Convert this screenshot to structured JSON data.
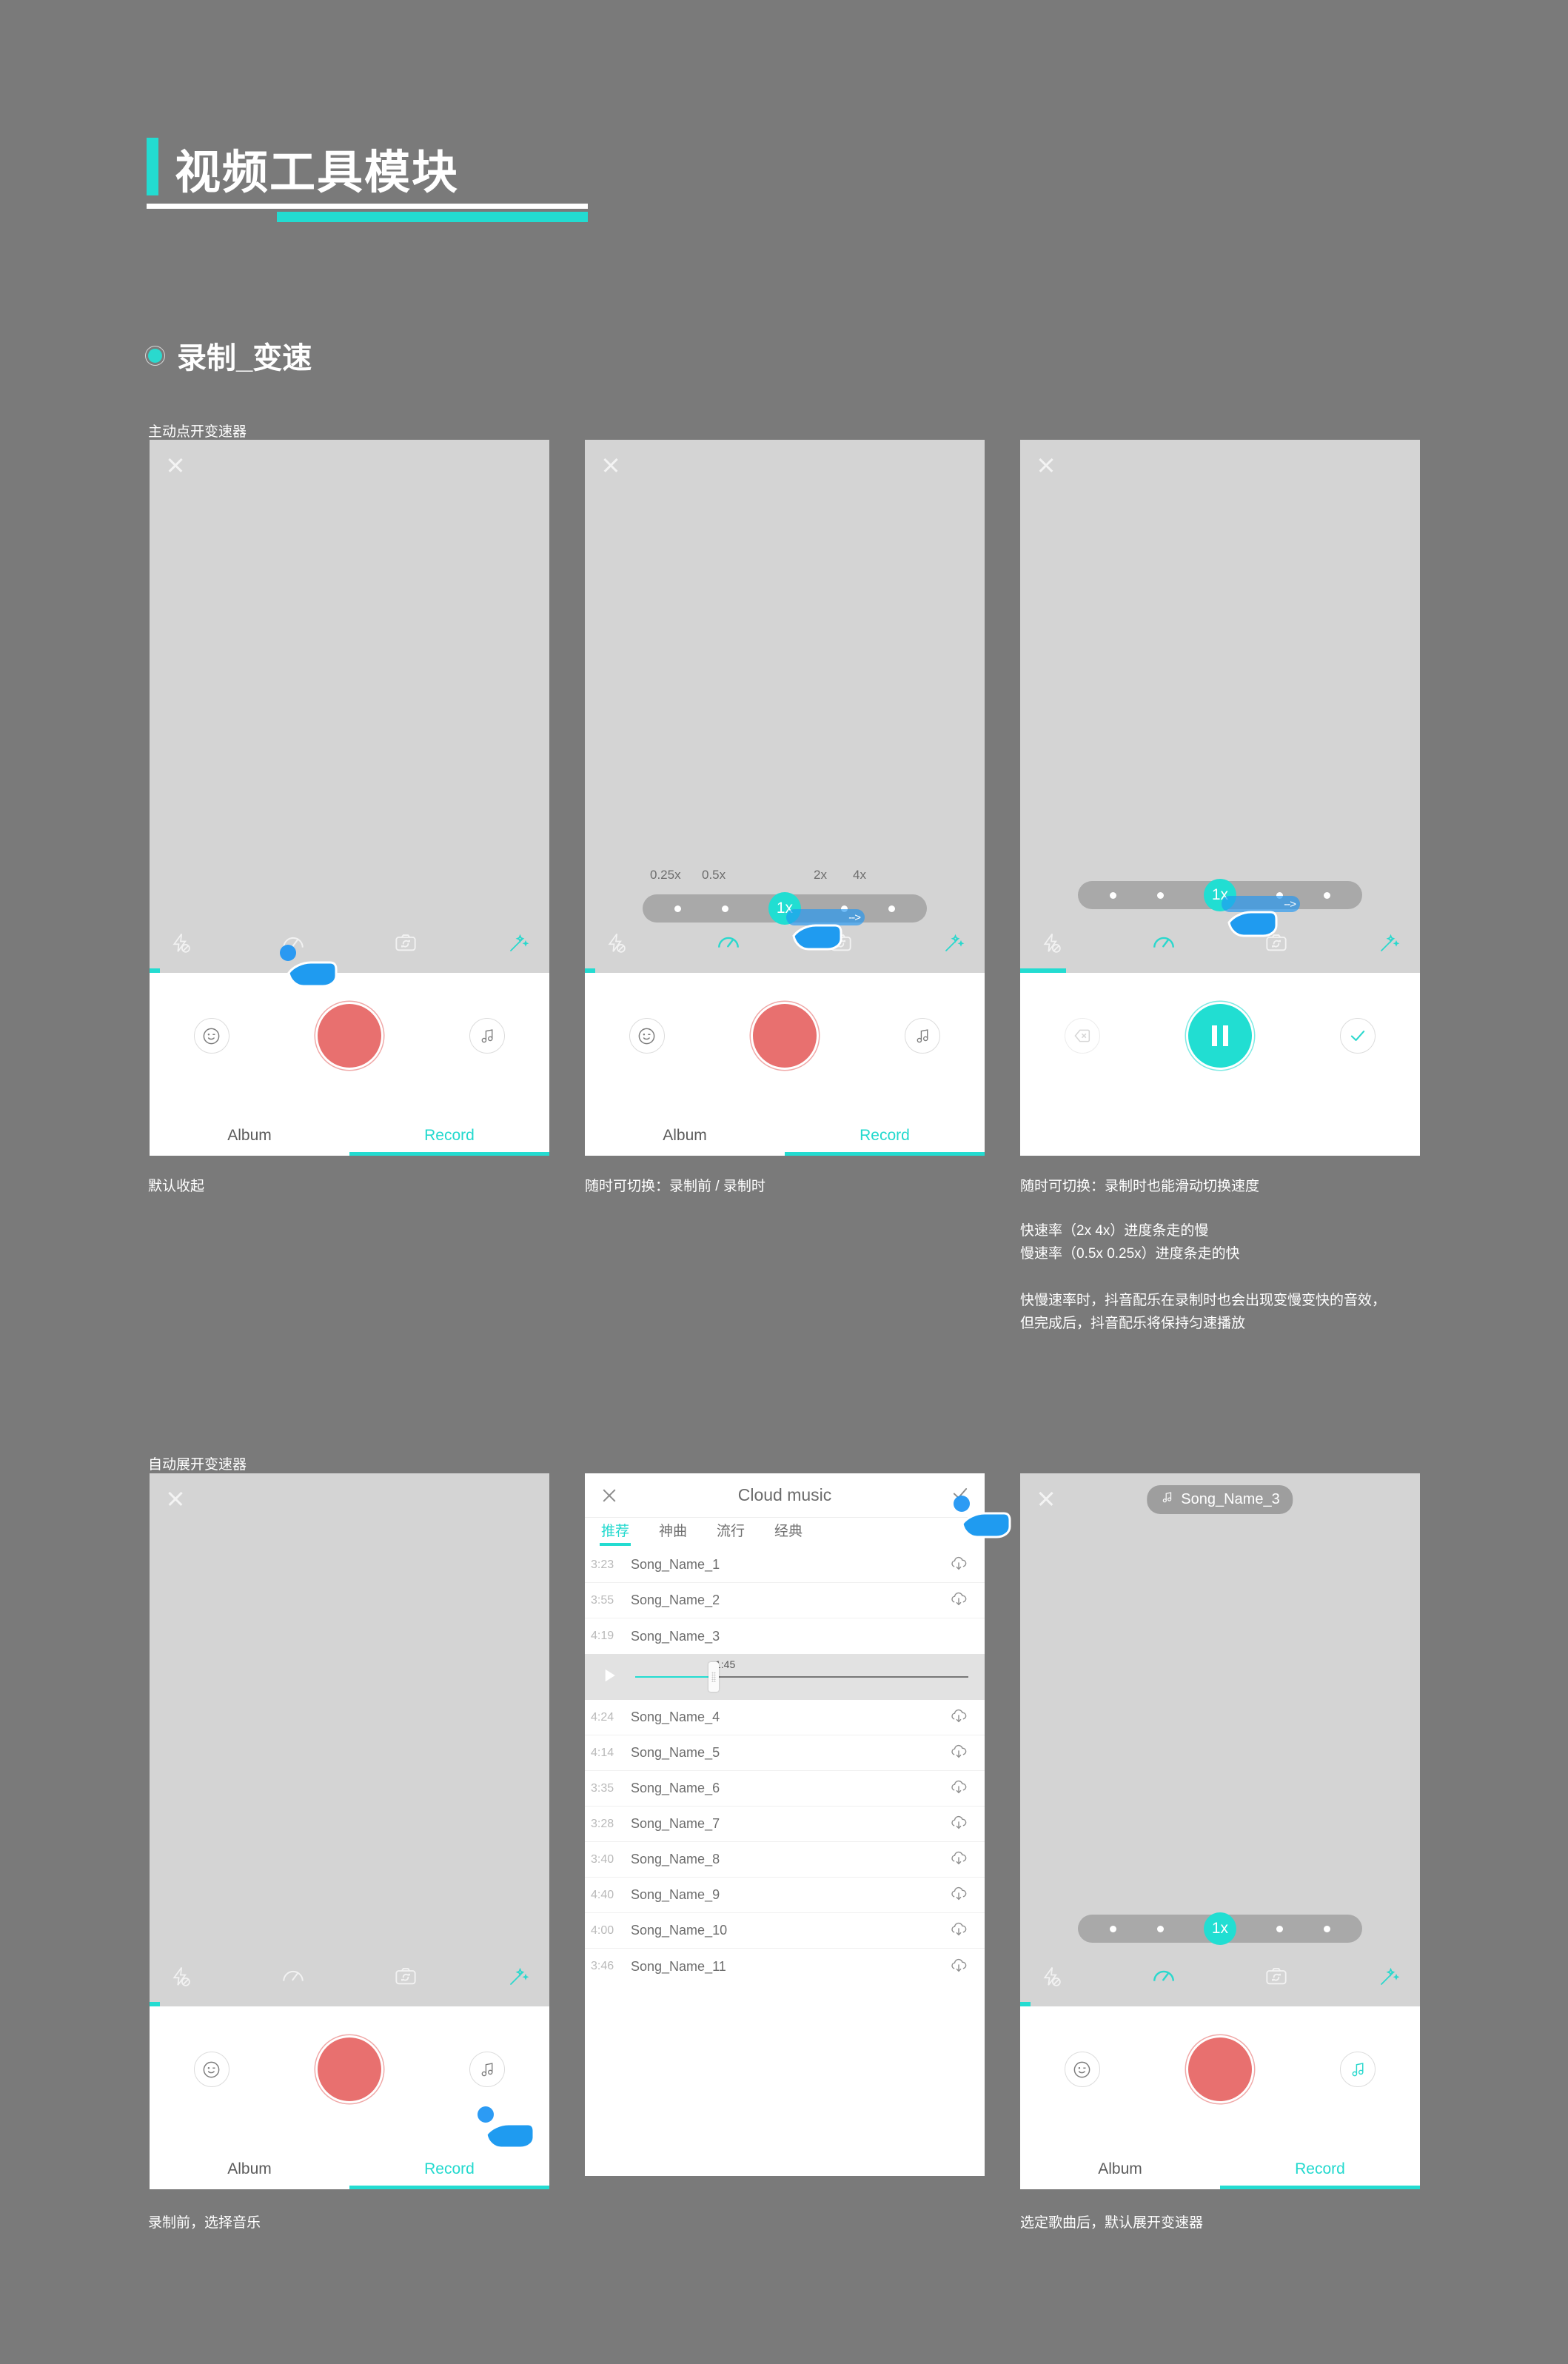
{
  "page": {
    "title": "视频工具模块",
    "section_heading": "录制_变速",
    "accent_color": "#23dcd1",
    "background_color": "#7a7a7a",
    "record_red": "#e8706f"
  },
  "groups": [
    {
      "label": "主动点开变速器"
    },
    {
      "label": "自动展开变速器"
    }
  ],
  "captions": {
    "r1c1": "默认收起",
    "r1c2": "随时可切换：录制前 / 录制时",
    "r1c3_line1": "随时可切换：录制时也能滑动切换速度",
    "r1c3_line2": "快速率（2x 4x）进度条走的慢\n慢速率（0.5x 0.25x）进度条走的快",
    "r1c3_line3": "快慢速率时，抖音配乐在录制时也会出现变慢变快的音效，\n但完成后，抖音配乐将保持匀速播放",
    "r2c1": "录制前，选择音乐",
    "r2c3": "选定歌曲后，默认展开变速器"
  },
  "camera": {
    "tabs": {
      "album": "Album",
      "record": "Record"
    },
    "toolbar_icons": [
      "flash-off-icon",
      "speed-icon",
      "camera-flip-icon",
      "magic-wand-icon"
    ],
    "speed": {
      "current": "1x",
      "labels": [
        "0.25x",
        "0.5x",
        "2x",
        "4x"
      ],
      "options": [
        "0.25x",
        "0.5x",
        "1x",
        "2x",
        "4x"
      ]
    },
    "buttons": {
      "sticker": "smiley-icon",
      "music": "music-note-icon",
      "shutter": "record-button",
      "delete": "delete-clip-icon",
      "confirm": "check-icon",
      "pause": "pause-icon"
    }
  },
  "song_badge": {
    "name": "Song_Name_3",
    "icon": "music-note-icon"
  },
  "cloud_music": {
    "title": "Cloud music",
    "close_icon": "close-icon",
    "confirm_icon": "check-icon",
    "tabs": [
      {
        "label": "推荐",
        "active": true
      },
      {
        "label": "神曲",
        "active": false
      },
      {
        "label": "流行",
        "active": false
      },
      {
        "label": "经典",
        "active": false
      }
    ],
    "player": {
      "time": "1:45",
      "play_icon": "play-icon",
      "progress_pct": 24
    },
    "songs_top": [
      {
        "duration": "3:23",
        "name": "Song_Name_1",
        "action": "download-icon"
      },
      {
        "duration": "3:55",
        "name": "Song_Name_2",
        "action": "download-icon"
      },
      {
        "duration": "4:19",
        "name": "Song_Name_3",
        "action": ""
      }
    ],
    "songs_bottom": [
      {
        "duration": "4:24",
        "name": "Song_Name_4",
        "action": "download-icon"
      },
      {
        "duration": "4:14",
        "name": "Song_Name_5",
        "action": "download-icon"
      },
      {
        "duration": "3:35",
        "name": "Song_Name_6",
        "action": "download-icon"
      },
      {
        "duration": "3:28",
        "name": "Song_Name_7",
        "action": "download-icon"
      },
      {
        "duration": "3:40",
        "name": "Song_Name_8",
        "action": "download-icon"
      },
      {
        "duration": "4:40",
        "name": "Song_Name_9",
        "action": "download-icon"
      },
      {
        "duration": "4:00",
        "name": "Song_Name_10",
        "action": "download-icon"
      },
      {
        "duration": "3:46",
        "name": "Song_Name_11",
        "action": "download-icon"
      }
    ]
  }
}
